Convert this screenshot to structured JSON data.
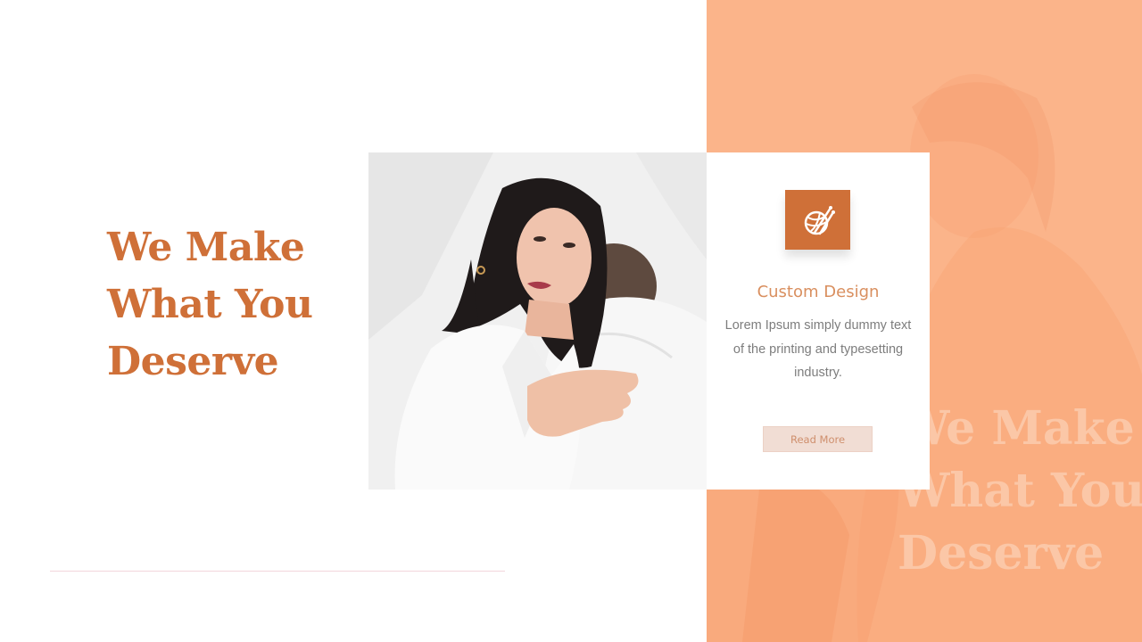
{
  "headline": {
    "line1": "We Make",
    "line2": "What You",
    "line3": "Deserve"
  },
  "watermark": {
    "line1": "We Make",
    "line2": "What You",
    "line3": "Deserve"
  },
  "card": {
    "icon": "knitting-yarn-icon",
    "title": "Custom Design",
    "text": "Lorem Ipsum simply dummy text of the printing and typesetting industry.",
    "button_label": "Read More"
  },
  "colors": {
    "accent": "#cf7038",
    "panel": "#fbb48a",
    "button_bg": "#f1ddd4"
  }
}
